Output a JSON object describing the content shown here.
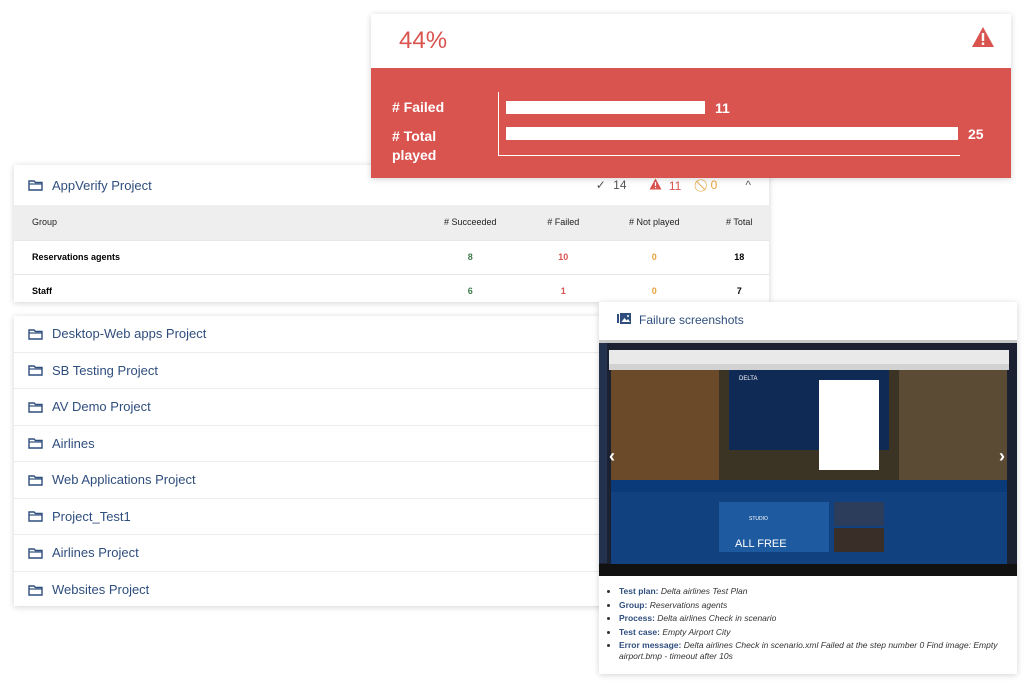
{
  "summary": {
    "percent": "44%",
    "bar_chart": {
      "rows": [
        {
          "label": "# Failed",
          "value": 11
        },
        {
          "label": "# Total played",
          "value": 25
        }
      ],
      "max": 25
    },
    "colors": {
      "accent": "#d9534f",
      "link": "#2f4e7d",
      "success": "#3e7c4c",
      "warning": "#e6a13a"
    }
  },
  "appverify": {
    "title": "AppVerify Project",
    "succeeded_count": "14",
    "failed_count": "11",
    "not_played_count": "0",
    "columns": [
      "Group",
      "# Succeeded",
      "# Failed",
      "# Not played",
      "# Total"
    ],
    "rows": [
      {
        "group": "Reservations agents",
        "succeeded": "8",
        "failed": "10",
        "not_played": "0",
        "total": "18"
      },
      {
        "group": "Staff",
        "succeeded": "6",
        "failed": "1",
        "not_played": "0",
        "total": "7"
      }
    ]
  },
  "projects": [
    "Desktop-Web apps Project",
    "SB Testing Project",
    "AV Demo Project",
    "Airlines",
    "Web Applications Project",
    "Project_Test1",
    "Airlines Project",
    "Websites Project"
  ],
  "failure": {
    "title": "Failure screenshots",
    "screenshot": {
      "brand": "DELTA",
      "promo": "ALL FREE",
      "studio": "STUDIO"
    },
    "details": [
      {
        "key": "Test plan:",
        "value": "Delta airlines Test Plan"
      },
      {
        "key": "Group:",
        "value": "Reservations agents"
      },
      {
        "key": "Process:",
        "value": "Delta airlines Check in scenario"
      },
      {
        "key": "Test case:",
        "value": "Empty Airport City"
      },
      {
        "key": "Error message:",
        "value": "Delta airlines Check in scenario.xml Failed at the step number 0 Find image: Empty airport.bmp - timeout after 10s"
      }
    ]
  }
}
